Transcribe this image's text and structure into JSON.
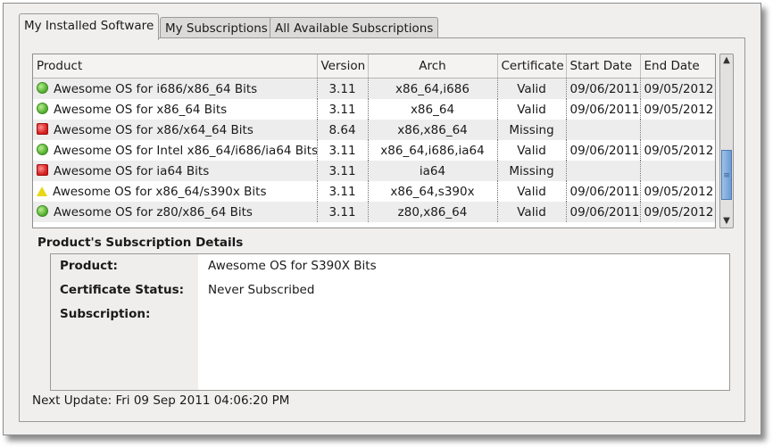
{
  "tabs": [
    {
      "label": "My Installed Software",
      "active": true
    },
    {
      "label": "My Subscriptions",
      "active": false
    },
    {
      "label": "All Available Subscriptions",
      "active": false
    }
  ],
  "table": {
    "columns": [
      "Product",
      "Version",
      "Arch",
      "Certificate",
      "Start Date",
      "End Date"
    ],
    "rows": [
      {
        "status": "valid",
        "product": "Awesome OS for i686/x86_64 Bits",
        "version": "3.11",
        "arch": "x86_64,i686",
        "certificate": "Valid",
        "start": "09/06/2011",
        "end": "09/05/2012"
      },
      {
        "status": "valid",
        "product": "Awesome OS for x86_64 Bits",
        "version": "3.11",
        "arch": "x86_64",
        "certificate": "Valid",
        "start": "09/06/2011",
        "end": "09/05/2012"
      },
      {
        "status": "missing",
        "product": "Awesome OS for x86/x64_64 Bits",
        "version": "8.64",
        "arch": "x86,x86_64",
        "certificate": "Missing",
        "start": "",
        "end": ""
      },
      {
        "status": "valid",
        "product": "Awesome OS for Intel x86_64/i686/ia64 Bits",
        "version": "3.11",
        "arch": "x86_64,i686,ia64",
        "certificate": "Valid",
        "start": "09/06/2011",
        "end": "09/05/2012"
      },
      {
        "status": "missing",
        "product": "Awesome OS for ia64 Bits",
        "version": "3.11",
        "arch": "ia64",
        "certificate": "Missing",
        "start": "",
        "end": ""
      },
      {
        "status": "warning",
        "product": "Awesome OS for x86_64/s390x Bits",
        "version": "3.11",
        "arch": "x86_64,s390x",
        "certificate": "Valid",
        "start": "09/06/2011",
        "end": "09/05/2012"
      },
      {
        "status": "valid",
        "product": "Awesome OS for z80/x86_64 Bits",
        "version": "3.11",
        "arch": "z80,x86_64",
        "certificate": "Valid",
        "start": "09/06/2011",
        "end": "09/05/2012"
      }
    ]
  },
  "status_colors": {
    "valid": "#4ea92b",
    "missing": "#d01c1c",
    "warning": "#e9d818"
  },
  "details": {
    "title": "Product's Subscription Details",
    "product_label": "Product:",
    "product_value": "Awesome OS for S390X Bits",
    "cert_status_label": "Certificate Status:",
    "cert_status_value": "Never Subscribed",
    "subscription_label": "Subscription:",
    "subscription_value": ""
  },
  "footer": {
    "next_update": "Next Update: Fri 09 Sep 2011 04:06:20 PM"
  }
}
